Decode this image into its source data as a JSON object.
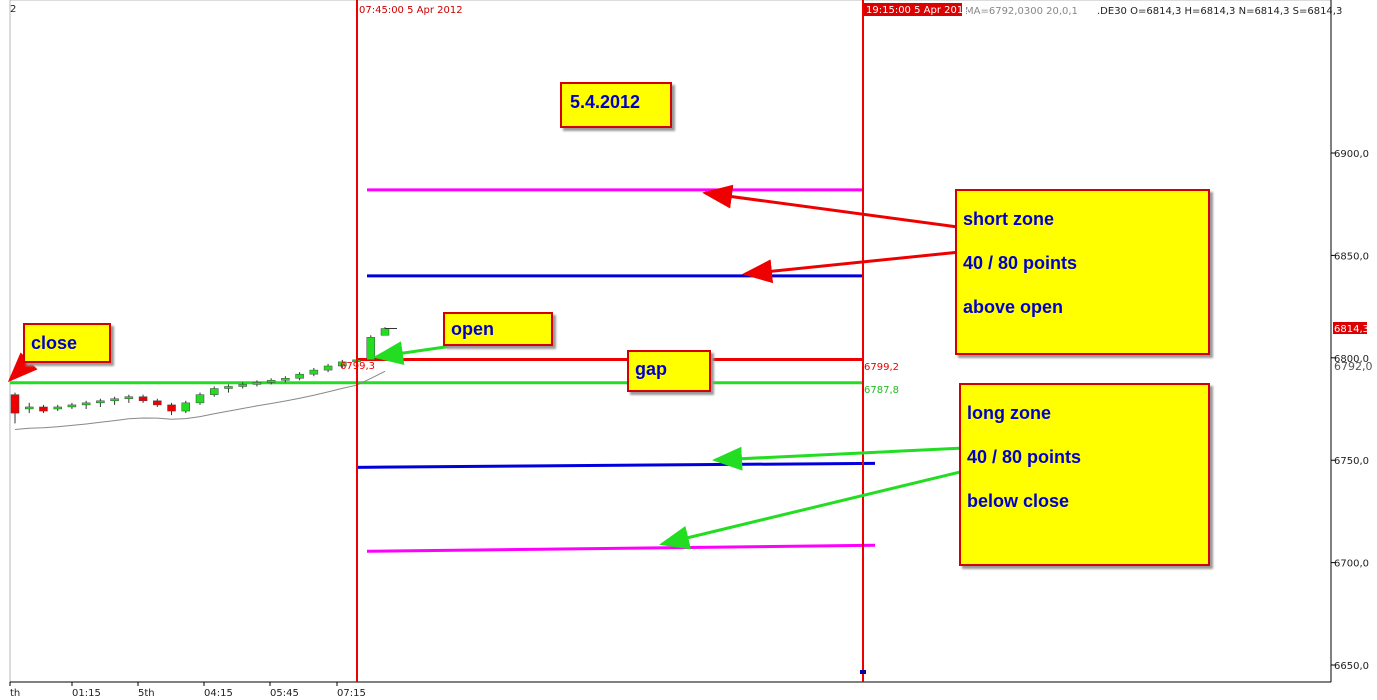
{
  "chart_data": {
    "type": "candlestick",
    "header": {
      "symbol_info": ".DE30 O=6814,3 H=6814,3 N=6814,3 S=6814,3",
      "ma_info": "MA=6792,0300  20,0,1",
      "left_marker": "2"
    },
    "y_axis": {
      "ylim": [
        6650,
        6945
      ],
      "ticks": [
        {
          "value": 6900,
          "label": "6900,0"
        },
        {
          "value": 6850,
          "label": "6850,0"
        },
        {
          "value": 6800,
          "label": "6800,0"
        },
        {
          "value": 6750,
          "label": "6750,0"
        },
        {
          "value": 6700,
          "label": "6700,0"
        },
        {
          "value": 6650,
          "label": "6650,0"
        }
      ],
      "price_tags": [
        {
          "value": 6814.3,
          "label": "6814,3",
          "bg": "#dd0000",
          "fg": "#ffffff"
        },
        {
          "value": 6792.0,
          "label": "6792,0",
          "bg": "#ffffff",
          "fg": "#555555"
        }
      ]
    },
    "x_axis": {
      "ticks": [
        "th",
        "01:15",
        "5th",
        "04:15",
        "05:45",
        "07:15"
      ]
    },
    "vertical_lines": [
      {
        "label": "07:45:00 5 Apr 2012",
        "color": "#ee0000"
      },
      {
        "label": "19:15:00 5 Apr 2012",
        "color": "#ee0000"
      }
    ],
    "horizontal_levels": [
      {
        "name": "short 80",
        "value": 6882,
        "color": "#ff00ff"
      },
      {
        "name": "short 40",
        "value": 6840,
        "color": "#0000dd"
      },
      {
        "name": "open",
        "value": 6799.2,
        "color": "#ee0000",
        "label": "6799,2"
      },
      {
        "name": "close",
        "value": 6787.8,
        "color": "#22dd22",
        "label": "6787,8"
      },
      {
        "name": "long 40",
        "value": 6747.5,
        "color": "#0000dd"
      },
      {
        "name": "long 80",
        "value": 6707,
        "color": "#ff00ff"
      }
    ],
    "level_text_near_open": "6799,3",
    "candles": [
      {
        "o": 6782,
        "h": 6783,
        "l": 6768,
        "c": 6773
      },
      {
        "o": 6776,
        "h": 6778,
        "l": 6773,
        "c": 6776
      },
      {
        "o": 6776,
        "h": 6777,
        "l": 6773,
        "c": 6774
      },
      {
        "o": 6775,
        "h": 6777,
        "l": 6774,
        "c": 6776
      },
      {
        "o": 6776,
        "h": 6778,
        "l": 6775,
        "c": 6777
      },
      {
        "o": 6777,
        "h": 6779,
        "l": 6775,
        "c": 6778
      },
      {
        "o": 6778,
        "h": 6780,
        "l": 6776,
        "c": 6779
      },
      {
        "o": 6779,
        "h": 6781,
        "l": 6777,
        "c": 6780
      },
      {
        "o": 6780,
        "h": 6782,
        "l": 6778,
        "c": 6781
      },
      {
        "o": 6781,
        "h": 6782,
        "l": 6778,
        "c": 6779
      },
      {
        "o": 6779,
        "h": 6780,
        "l": 6776,
        "c": 6777
      },
      {
        "o": 6777,
        "h": 6778,
        "l": 6772,
        "c": 6774
      },
      {
        "o": 6774,
        "h": 6779,
        "l": 6773,
        "c": 6778
      },
      {
        "o": 6778,
        "h": 6783,
        "l": 6777,
        "c": 6782
      },
      {
        "o": 6782,
        "h": 6786,
        "l": 6781,
        "c": 6785
      },
      {
        "o": 6785,
        "h": 6787,
        "l": 6783,
        "c": 6786
      },
      {
        "o": 6786,
        "h": 6788,
        "l": 6785,
        "c": 6787
      },
      {
        "o": 6787,
        "h": 6789,
        "l": 6786,
        "c": 6788
      },
      {
        "o": 6788,
        "h": 6790,
        "l": 6787,
        "c": 6789
      },
      {
        "o": 6789,
        "h": 6791,
        "l": 6788,
        "c": 6790
      },
      {
        "o": 6790,
        "h": 6793,
        "l": 6789,
        "c": 6792
      },
      {
        "o": 6792,
        "h": 6795,
        "l": 6791,
        "c": 6794
      },
      {
        "o": 6794,
        "h": 6797,
        "l": 6793,
        "c": 6796
      },
      {
        "o": 6796,
        "h": 6799,
        "l": 6795,
        "c": 6798
      },
      {
        "o": 6798,
        "h": 6800,
        "l": 6797,
        "c": 6799
      },
      {
        "o": 6799,
        "h": 6811,
        "l": 6799,
        "c": 6810
      },
      {
        "o": 6811,
        "h": 6815,
        "l": 6811,
        "c": 6814.3
      }
    ]
  },
  "annotations": {
    "date": "5.4.2012",
    "close": "close",
    "open": "open",
    "gap": "gap",
    "short_zone": [
      "short zone",
      "40 / 80 points",
      "above open"
    ],
    "long_zone": [
      "long zone",
      "40 / 80 points",
      "below close"
    ]
  },
  "colors": {
    "up_candle": "#22dd22",
    "down_candle": "#ee0000",
    "ma_line": "#888888",
    "annotation_box": "#ffff00",
    "annotation_text": "#0000cc"
  }
}
